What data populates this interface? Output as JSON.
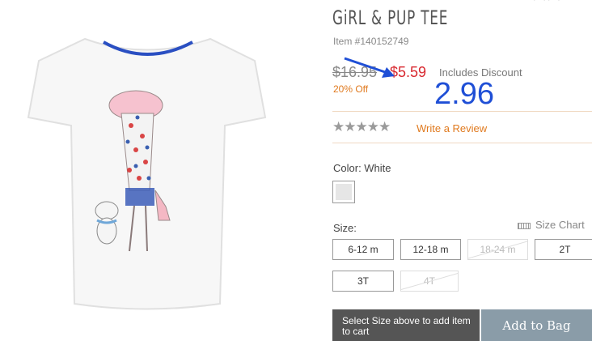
{
  "product": {
    "title": "GiRL & PUP TEE",
    "item_number": "Item #140152749",
    "original_price": "$16.95",
    "sale_price": "$5.59",
    "includes_discount": "Includes Discount",
    "discount": "20% Off",
    "annotation_value": "2.96",
    "review_link": "Write a Review",
    "rating_stars": "★★★★★",
    "color_label": "Color: White",
    "size_label": "Size:",
    "size_chart": "Size Chart",
    "sizes": [
      {
        "label": "6-12 m",
        "available": true
      },
      {
        "label": "12-18 m",
        "available": true
      },
      {
        "label": "18-24 m",
        "available": false
      },
      {
        "label": "2T",
        "available": true
      },
      {
        "label": "3T",
        "available": true
      },
      {
        "label": "4T",
        "available": false
      }
    ],
    "cart_message": "Select Size above to add item to cart",
    "add_to_bag": "Add to Bag"
  },
  "colors": {
    "sale_red": "#d8282f",
    "accent_orange": "#e07a1f",
    "annotation_blue": "#1f4fd6",
    "button_gray": "#8a9ca8"
  },
  "icons": [
    "ruler-icon",
    "annotation-arrow-icon",
    "star-icon"
  ]
}
